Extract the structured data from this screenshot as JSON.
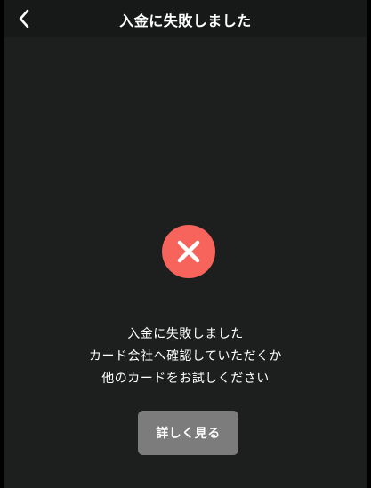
{
  "header": {
    "title": "入金に失敗しました",
    "back_icon": "chevron-left-icon"
  },
  "status": {
    "icon": "error-x-icon",
    "icon_color": "#f6645c"
  },
  "message": {
    "lines": [
      "入金に失敗しました",
      "カード会社へ確認していただくか",
      "他のカードをお試しください"
    ]
  },
  "actions": {
    "details_label": "詳しく見る"
  },
  "colors": {
    "background": "#1d1f1e",
    "button": "#7b7c7b",
    "text": "#ffffff"
  }
}
